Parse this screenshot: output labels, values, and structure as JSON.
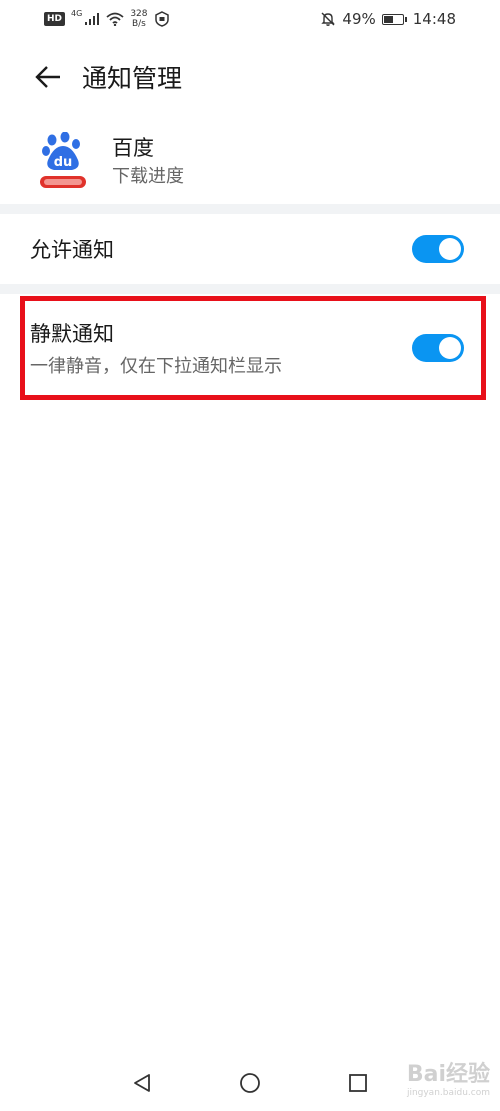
{
  "status_bar": {
    "hd": "HD",
    "network": "4G",
    "speed_value": "328",
    "speed_unit": "B/s",
    "battery": "49%",
    "time": "14:48"
  },
  "header": {
    "title": "通知管理"
  },
  "app": {
    "name": "百度",
    "channel": "下载进度"
  },
  "settings": {
    "allow_notifications": {
      "label": "允许通知",
      "enabled": true
    },
    "silent_notifications": {
      "label": "静默通知",
      "description": "一律静音，仅在下拉通知栏显示",
      "enabled": true
    }
  },
  "colors": {
    "toggle_on": "#0a95f2",
    "highlight": "#e8101a",
    "band": "#f1f3f5"
  },
  "watermark": {
    "text": "Bai经验",
    "url": "jingyan.baidu.com"
  }
}
